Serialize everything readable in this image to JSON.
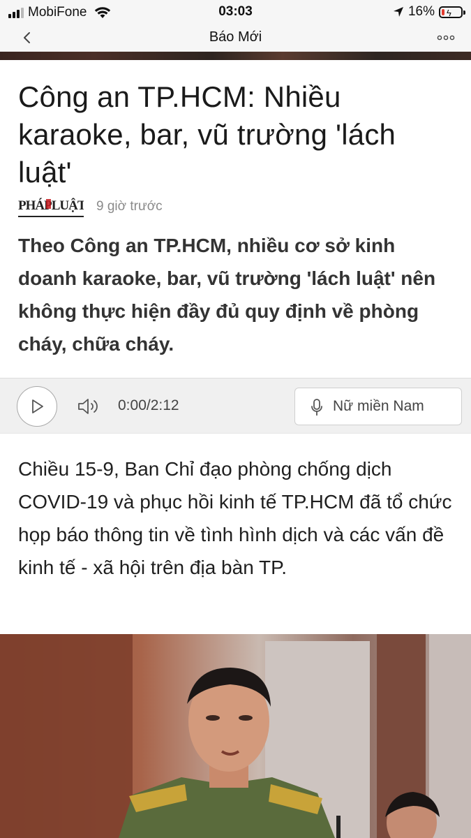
{
  "status_bar": {
    "carrier": "MobiFone",
    "time": "03:03",
    "battery_percent": "16%",
    "battery_level": 0.16,
    "signal_bars": 3
  },
  "nav": {
    "title": "Báo Mới",
    "back_icon": "chevron-left-icon",
    "more_icon": "ellipsis-icon"
  },
  "article": {
    "headline": "Công an TP.HCM: Nhiều karaoke, bar, vũ trường 'lách luật'",
    "source_logo": "PHÁPLUẬT",
    "time_ago": "9 giờ trước",
    "summary": "Theo Công an TP.HCM, nhiều cơ sở kinh doanh karaoke, bar, vũ trường 'lách luật' nên không thực hiện đầy đủ quy định về phòng cháy, chữa cháy.",
    "body": "Chiều 15-9, Ban Chỉ đạo phòng chống dịch COVID-19 và phục hồi kinh tế TP.HCM đã tổ chức họp báo thông tin về tình hình dịch và các vấn đề kinh tế - xã hội trên địa bàn TP."
  },
  "audio": {
    "time": "0:00/2:12",
    "voice_label": "Nữ miền Nam",
    "play_icon": "play-icon",
    "volume_icon": "speaker-icon",
    "mic_icon": "microphone-icon"
  },
  "colors": {
    "battery_low": "#e23b2e",
    "logo_red": "#c51a1f",
    "bar_bg": "#f6f6f6"
  }
}
